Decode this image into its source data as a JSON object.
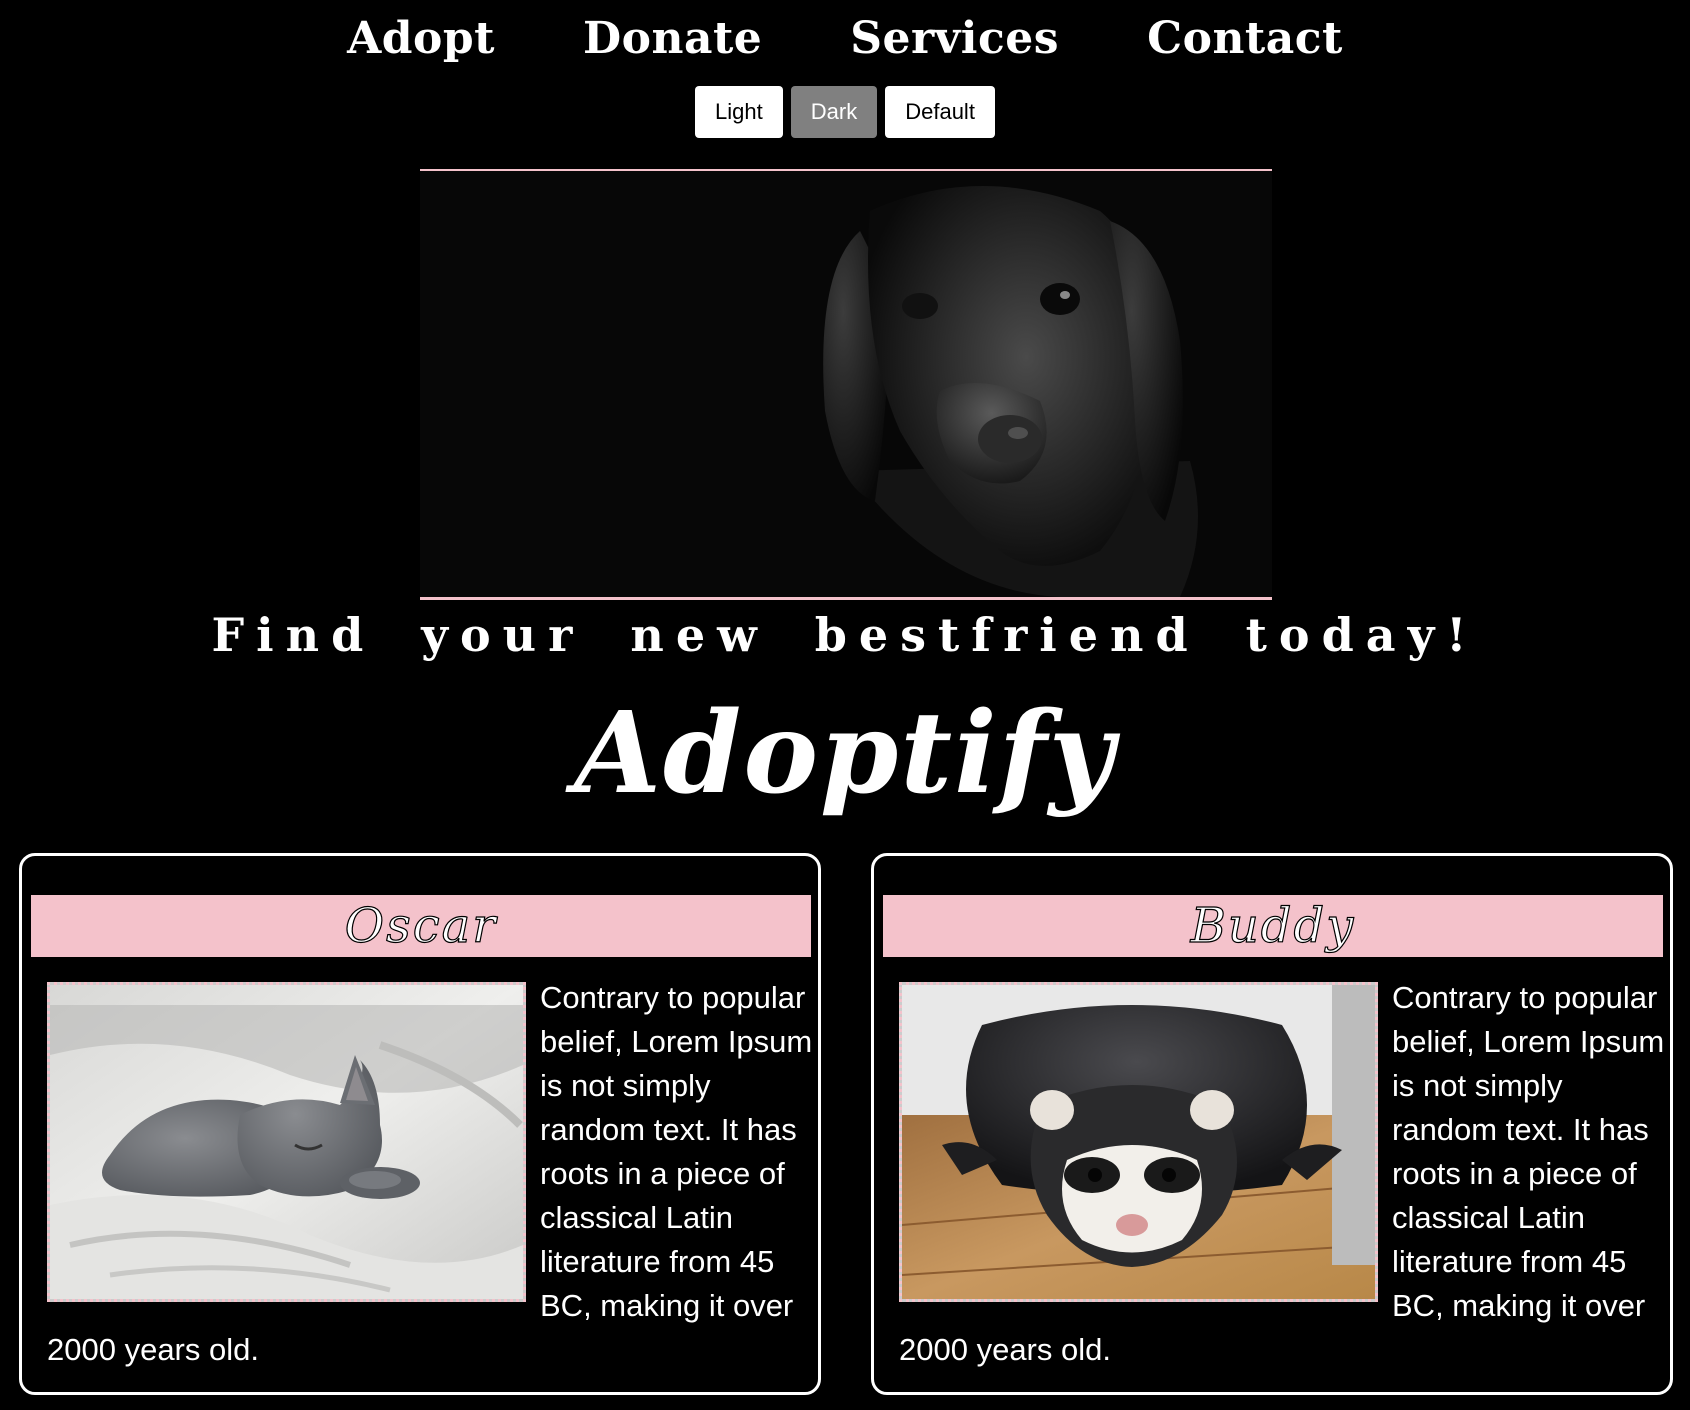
{
  "nav": {
    "items": [
      {
        "label": "Adopt"
      },
      {
        "label": "Donate"
      },
      {
        "label": "Services"
      },
      {
        "label": "Contact"
      }
    ]
  },
  "theme": {
    "buttons": [
      {
        "label": "Light",
        "active": false
      },
      {
        "label": "Dark",
        "active": true
      },
      {
        "label": "Default",
        "active": false
      }
    ]
  },
  "hero": {
    "image": "black-labrador-puppy-photo"
  },
  "tagline": "Find your new bestfriend today!",
  "brand": "Adoptify",
  "pets": [
    {
      "name": "Oscar",
      "image": "sleeping-gray-cat-photo",
      "description": "Contrary to popular belief, Lorem Ipsum is not simply random text. It has roots in a piece of classical Latin literature from 45 BC, making it over 2000 years old."
    },
    {
      "name": "Buddy",
      "image": "ferret-on-floor-photo",
      "description": "Contrary to popular belief, Lorem Ipsum is not simply random text. It has roots in a piece of classical Latin literature from 45 BC, making it over 2000 years old."
    }
  ],
  "colors": {
    "background": "#000000",
    "accent_pink": "#f4c2cb",
    "text": "#ffffff",
    "active_button": "#808080"
  }
}
